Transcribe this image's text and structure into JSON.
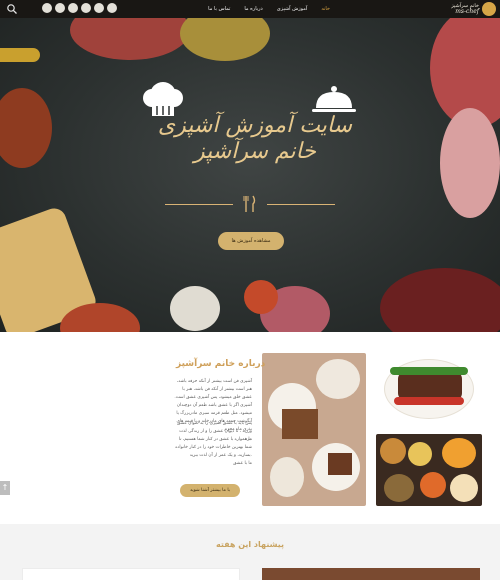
{
  "nav": {
    "menu": [
      {
        "label": "خانه",
        "active": true
      },
      {
        "label": "آموزش آشپزی",
        "active": false
      },
      {
        "label": "درباره ما",
        "active": false
      },
      {
        "label": "تماس با ما",
        "active": false
      }
    ],
    "logo": {
      "line1": "خانم سرآشپز",
      "line2": "ms-chef"
    },
    "social_icons": [
      "social-icon-1",
      "social-icon-2",
      "social-icon-3",
      "social-icon-4",
      "social-icon-5",
      "social-icon-6"
    ]
  },
  "hero": {
    "title_line1": "سایت آموزش آشپزی",
    "title_line2": "خانم سرآشپز",
    "cta_label": "مشاهده آموزش ها"
  },
  "about": {
    "title": "درباره خانم سرآشپز",
    "paragraph1": "آشپزی فن است بیشتر از آنکه حرفه باشد، هنر است بیشتر از آنکه فن باشد، هنر با عشق خلق میشود، پس آشپزی عشق است. آشپزی اگر با عشق باشد طعم آن دوچندان میشود. مثل طعم قرمه سبزی مادربزرگ یا آبگوشت جمعه های مادرخانه و یا قیمه های نذری ماه محرم",
    "paragraph2": "پس باید با عشق آشپزی را به عنوان عشق ورزید ، تا دیوان عشق را و از زندگی لذت برد.",
    "paragraph3": "ما همواره با عشق در کنار شما هستیم، تا شما بهترین خاطرات خود را در کنار خانواده بسازید، و یک عمر از آن لذت ببرید.",
    "paragraph4": "ما با عشق",
    "button_label": "با ما بیشتر آشنا شوید",
    "up_arrow": "↑"
  },
  "week": {
    "title": "پیشنهاد این هفته"
  },
  "colors": {
    "accent": "#d3b26e",
    "gold_text": "#cfa05a",
    "nav_bg": "#191714",
    "hero_bg": "#2c3130"
  }
}
